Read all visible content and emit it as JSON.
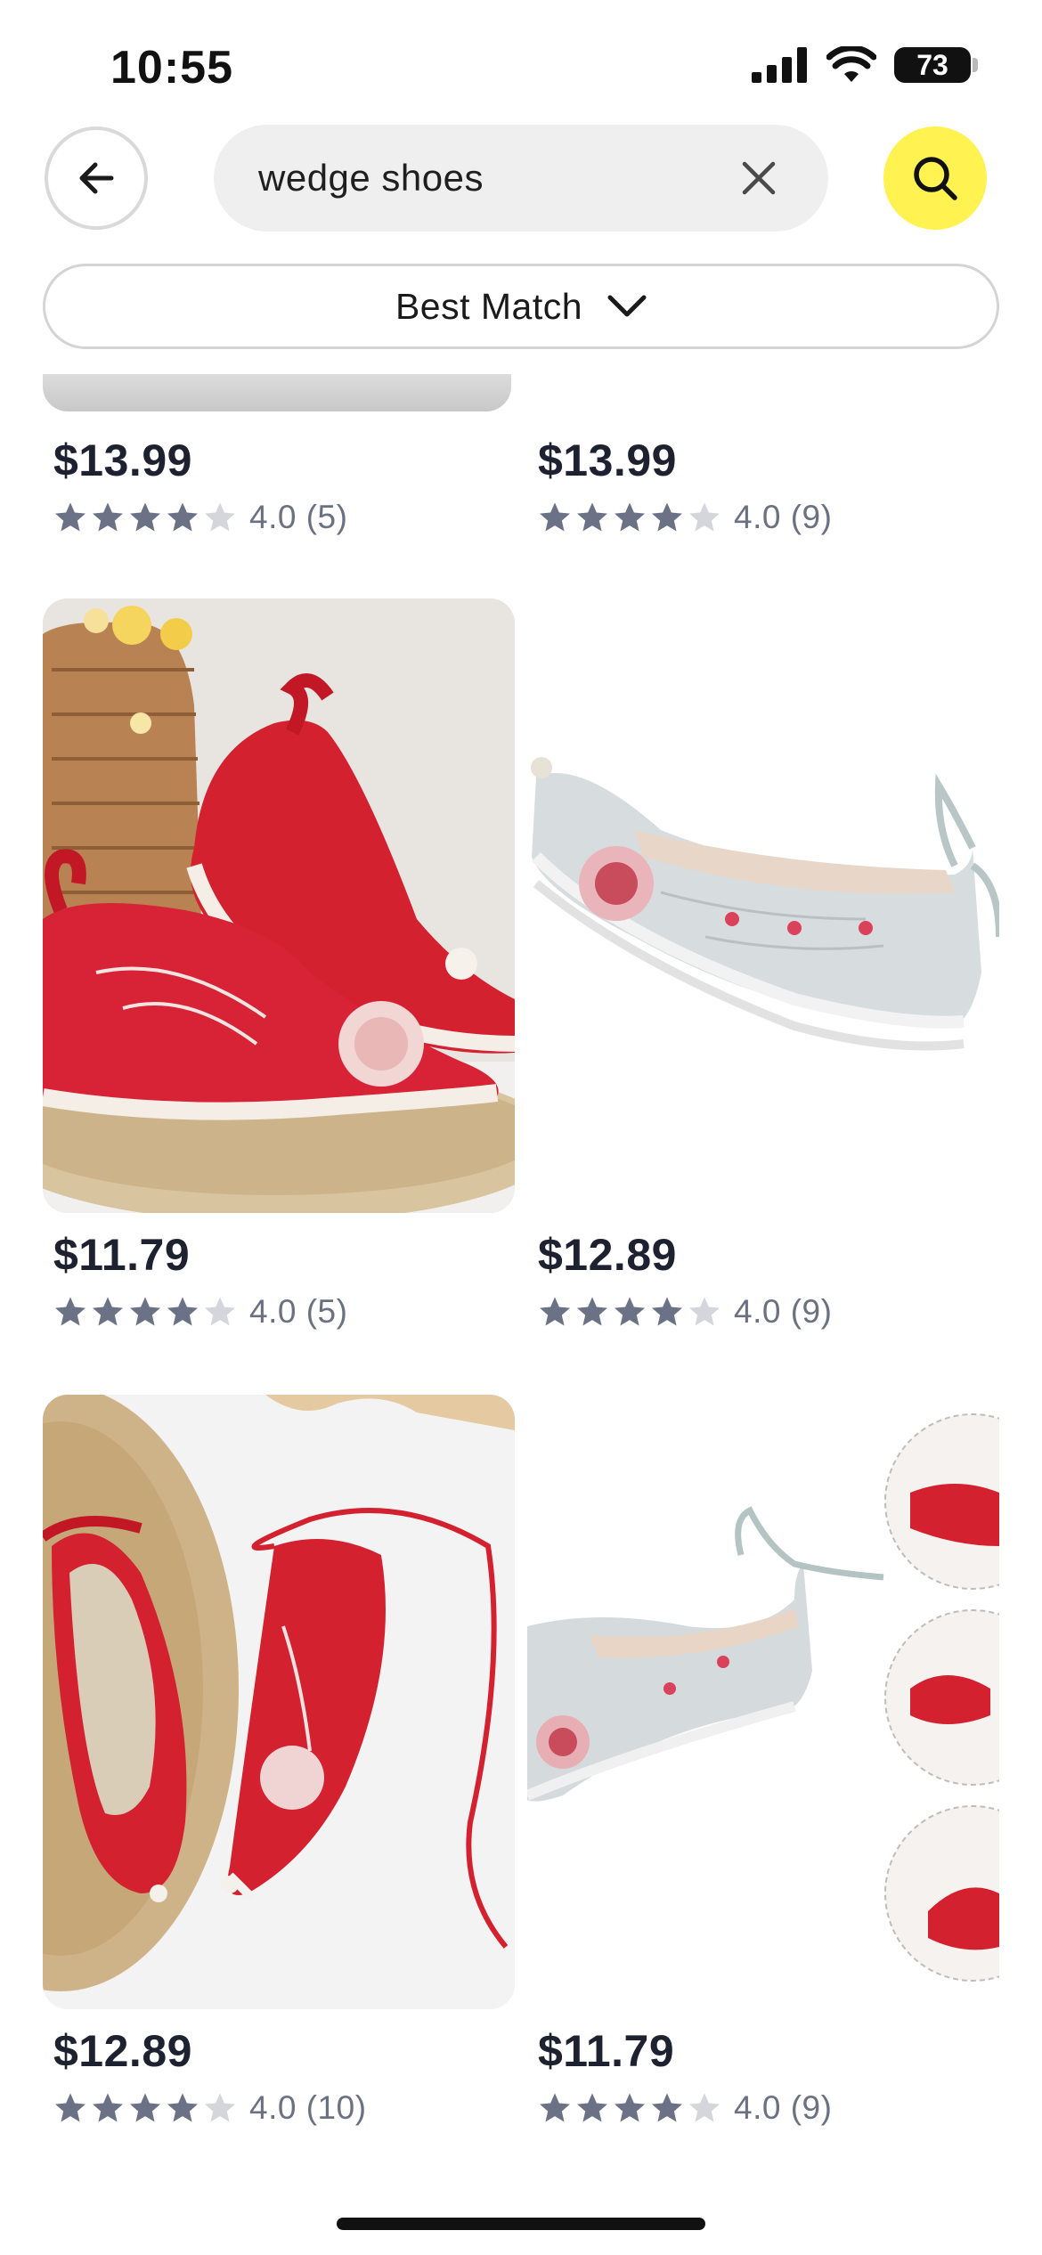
{
  "status_bar": {
    "time": "10:55",
    "battery": "73"
  },
  "search": {
    "query": "wedge shoes"
  },
  "sort": {
    "label": "Best Match"
  },
  "products": [
    {
      "price": "$13.99",
      "rating": 4,
      "rating_text": "4.0 (5)"
    },
    {
      "price": "$13.99",
      "rating": 4,
      "rating_text": "4.0 (9)"
    },
    {
      "price": "$11.79",
      "rating": 4,
      "rating_text": "4.0 (5)"
    },
    {
      "price": "$12.89",
      "rating": 4,
      "rating_text": "4.0 (9)"
    },
    {
      "price": "$12.89",
      "rating": 4,
      "rating_text": "4.0 (10)"
    },
    {
      "price": "$11.79",
      "rating": 4,
      "rating_text": "4.0 (9)"
    }
  ],
  "colors": {
    "accent_yellow": "#fff251",
    "shoe_red": "#d42130",
    "star_filled": "#6c7286",
    "star_empty": "#d4d6db"
  },
  "icons": {
    "back": "arrow-left-icon",
    "clear": "close-icon",
    "search": "search-icon",
    "sort": "chevron-down-icon",
    "star": "star-icon"
  }
}
